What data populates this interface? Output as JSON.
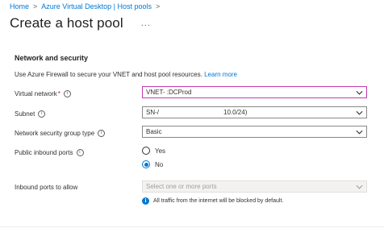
{
  "breadcrumb": {
    "items": [
      "Home",
      "Azure Virtual Desktop | Host pools"
    ],
    "separator": ">"
  },
  "header": {
    "title": "Create a host pool",
    "more_label": "..."
  },
  "section": {
    "title": "Network and security",
    "description": "Use Azure Firewall to secure your VNET and host pool resources.",
    "learn_more": "Learn more"
  },
  "fields": {
    "virtual_network": {
      "label": "Virtual network",
      "required_mark": "*",
      "value": "VNET-          :DCProd"
    },
    "subnet": {
      "label": "Subnet",
      "value": "SN-/                                    10.0/24)"
    },
    "nsg_type": {
      "label": "Network security group type",
      "value": "Basic"
    },
    "public_inbound": {
      "label": "Public inbound ports",
      "options": [
        "Yes",
        "No"
      ],
      "selected": "No"
    },
    "inbound_ports": {
      "label": "Inbound ports to allow",
      "placeholder": "Select one or more ports"
    }
  },
  "note": {
    "icon": "info-filled-icon",
    "text": "All traffic from the internet will be blocked by default."
  },
  "colors": {
    "accent": "#0078d4",
    "focus_border": "#c239b3",
    "required": "#a4262c",
    "text": "#323130"
  },
  "icons": {
    "info": "info-icon",
    "chevron": "chevron-down-icon"
  }
}
